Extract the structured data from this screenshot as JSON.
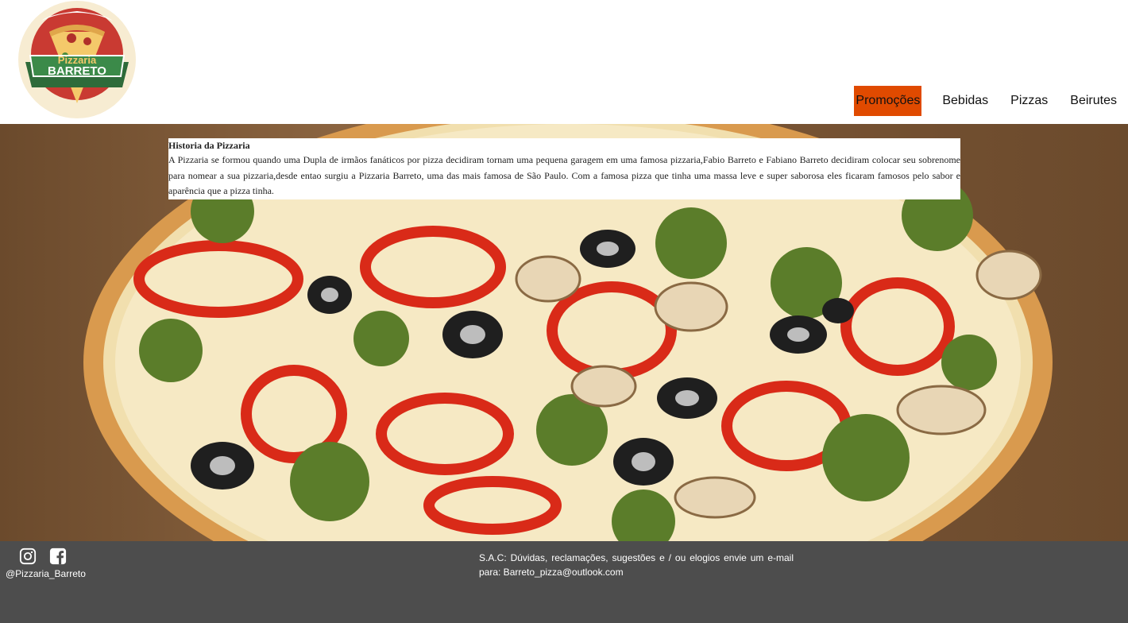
{
  "brand": {
    "logo_line1": "Pizzaria",
    "logo_line2": "BARRETO"
  },
  "nav": {
    "items": [
      {
        "label": "Promoções",
        "active": true
      },
      {
        "label": "Bebidas",
        "active": false
      },
      {
        "label": "Pizzas",
        "active": false
      },
      {
        "label": "Beirutes",
        "active": false
      }
    ]
  },
  "history": {
    "title": "Historia da Pizzaria",
    "text": "A Pizzaria se formou quando uma Dupla de irmãos fanáticos por pizza decidiram tornam uma pequena garagem em uma famosa pizzaria,Fabio Barreto e Fabiano Barreto decidiram colocar seu sobrenome para nomear a sua pizzaria,desde entao surgiu a Pizzaria Barreto, uma das mais famosa de São Paulo. Com a famosa pizza que tinha uma massa leve e super saborosa eles ficaram famosos pelo sabor e aparência que a pizza tinha."
  },
  "footer": {
    "social_icons": [
      "instagram-icon",
      "facebook-icon"
    ],
    "handle": "@Pizzaria_Barreto",
    "sac_text": "S.A.C: Dúvidas, reclamações, sugestões e / ou elogios envie um e-mail para: Barreto_pizza@outlook.com"
  },
  "colors": {
    "nav_active": "#e04a00",
    "footer_bg": "#4d4d4d",
    "logo_green": "#2e6b3a",
    "logo_red": "#c0392b"
  }
}
